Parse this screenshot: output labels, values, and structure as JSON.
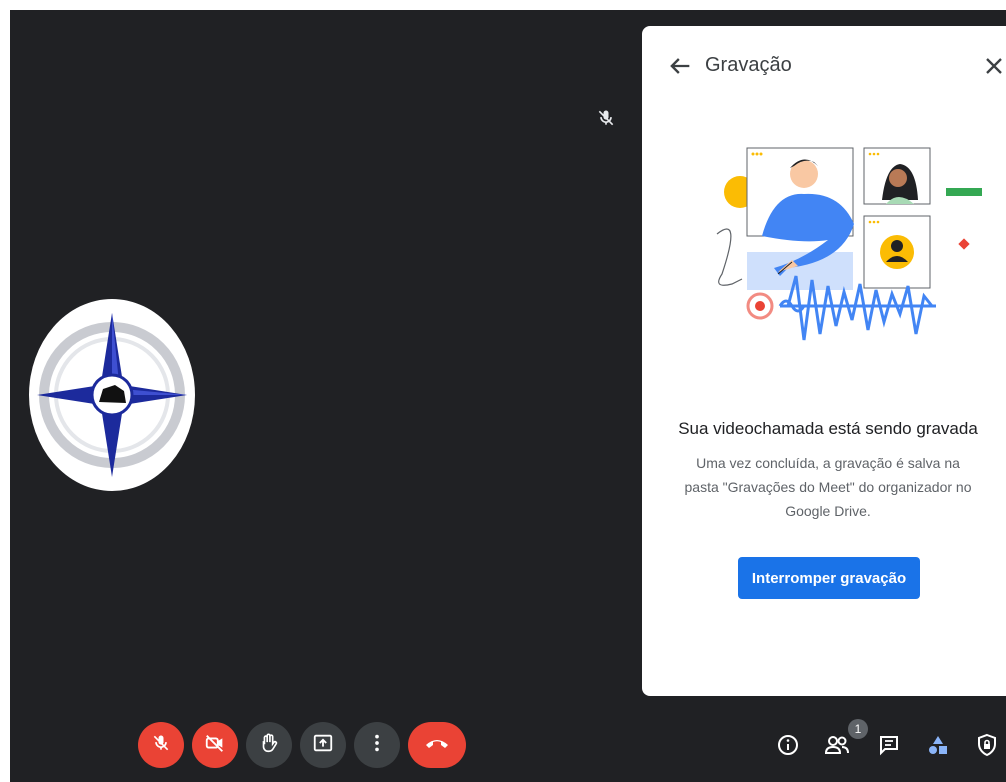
{
  "panel": {
    "title": "Gravação",
    "headline": "Sua videochamada está sendo gravada",
    "description": "Uma vez concluída, a gravação é salva na pasta \"Gravações do Meet\" do organizador no Google Drive.",
    "stop_button": "Interromper gravação"
  },
  "controls": {
    "mic": {
      "icon": "mic-off-icon",
      "state": "off"
    },
    "camera": {
      "icon": "camera-off-icon",
      "state": "off"
    },
    "raise_hand": {
      "icon": "raise-hand-icon"
    },
    "present": {
      "icon": "present-screen-icon"
    },
    "more": {
      "icon": "more-options-icon"
    },
    "end_call": {
      "icon": "end-call-icon"
    }
  },
  "side_controls": {
    "info": {
      "icon": "info-icon"
    },
    "people": {
      "icon": "people-icon",
      "badge": "1"
    },
    "chat": {
      "icon": "chat-icon"
    },
    "activities": {
      "icon": "activities-icon"
    },
    "host_controls": {
      "icon": "host-controls-icon"
    }
  },
  "colors": {
    "stage_bg": "#202124",
    "accent": "#1a73e8",
    "danger": "#ea4335",
    "control_gray": "#3c4043"
  }
}
